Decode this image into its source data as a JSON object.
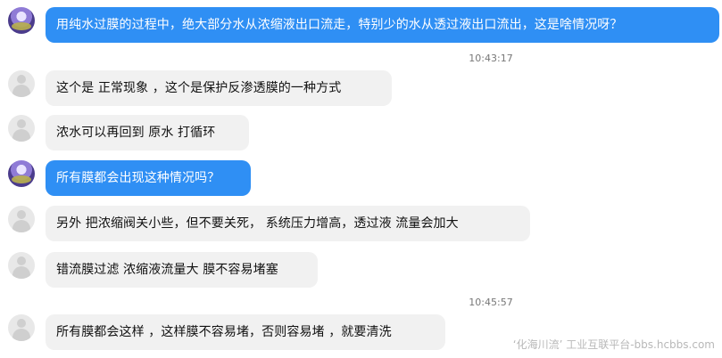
{
  "chat": {
    "messages": [
      {
        "role": "user",
        "text": "用纯水过膜的过程中，绝大部分水从浓缩液出口流走，特别少的水从透过液出口流出，这是啥情况呀？"
      },
      {
        "role": "timestamp",
        "text": "10:43:17"
      },
      {
        "role": "support",
        "text": "这个是 正常现象 ，这个是保护反渗透膜的一种方式"
      },
      {
        "role": "support",
        "text": "浓水可以再回到 原水 打循环"
      },
      {
        "role": "user",
        "text": "所有膜都会出现这种情况吗？"
      },
      {
        "role": "support",
        "text": "另外 把浓缩阀关小些，但不要关死， 系统压力增高，透过液 流量会加大"
      },
      {
        "role": "support",
        "text": "错流膜过滤 浓缩液流量大 膜不容易堵塞"
      },
      {
        "role": "timestamp",
        "text": "10:45:57"
      },
      {
        "role": "support",
        "text": "所有膜都会这样 ，这样膜不容易堵，否则容易堵 ，就要清洗"
      }
    ]
  },
  "watermark": {
    "text": "‘化海川流’ 工业互联平台-bbs.hcbbs.com"
  },
  "icons": {
    "user_avatar": "user-avatar-icon",
    "support_avatar": "support-avatar-icon"
  },
  "colors": {
    "user_bubble": "#2f8ff4",
    "support_bubble": "#f1f1f1"
  }
}
